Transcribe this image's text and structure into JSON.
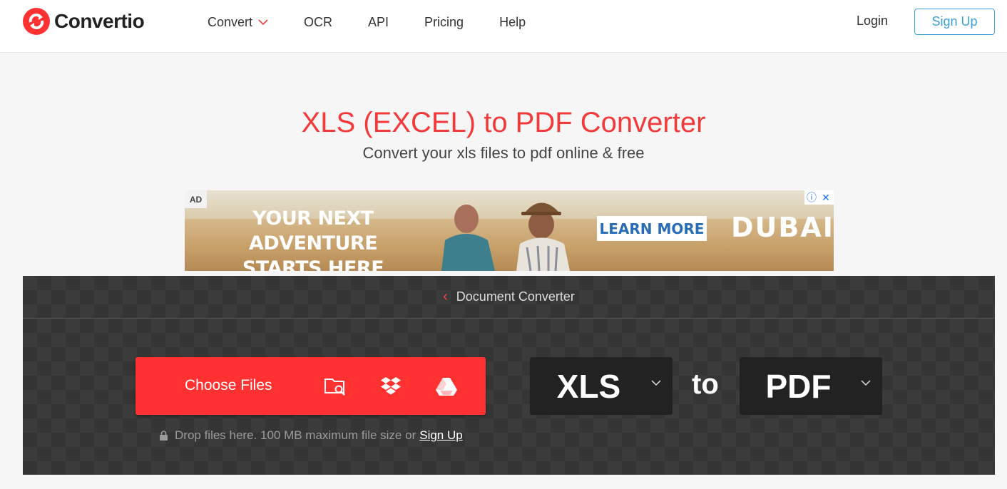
{
  "header": {
    "brand": "Convertio",
    "nav": [
      {
        "label": "Convert",
        "has_dropdown": true
      },
      {
        "label": "OCR"
      },
      {
        "label": "API"
      },
      {
        "label": "Pricing"
      },
      {
        "label": "Help"
      }
    ],
    "login_label": "Login",
    "signup_label": "Sign Up"
  },
  "hero": {
    "title": "XLS (EXCEL) to PDF Converter",
    "subtitle": "Convert your xls files to pdf online & free"
  },
  "ad": {
    "badge": "AD",
    "headline_line1": "YOUR NEXT ADVENTURE",
    "headline_line2": "STARTS HERE",
    "cta": "LEARN MORE",
    "brand": "DUBAI"
  },
  "converter": {
    "breadcrumb": "Document Converter",
    "choose_files_label": "Choose Files",
    "drop_text": "Drop files here. 100 MB maximum file size or",
    "drop_link": "Sign Up",
    "from_format": "XLS",
    "to_word": "to",
    "to_format": "PDF"
  },
  "colors": {
    "brand_red": "#ff3131",
    "title_red": "#f23a3a",
    "signup_blue": "#3aa0d8",
    "panel_bg": "#3b3b3b"
  },
  "icons": [
    "logo-icon",
    "chevron-down-icon",
    "folder-search-icon",
    "dropbox-icon",
    "google-drive-icon",
    "lock-icon",
    "chevron-left-icon",
    "ad-info-icon",
    "ad-close-icon"
  ]
}
